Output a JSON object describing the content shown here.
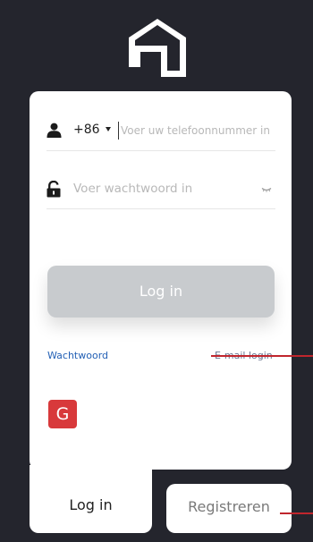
{
  "colors": {
    "background": "#24252d",
    "card": "#ffffff",
    "login_button": "#c8cbce",
    "link_blue": "#2360b5",
    "google_red": "#d8393b",
    "annotation_red": "#c0262d"
  },
  "logo": {
    "icon": "house-logo-icon"
  },
  "form": {
    "country_code": "+86",
    "phone_placeholder": "Voer uw telefoonnummer in",
    "password_placeholder": "Voer wachtwoord in",
    "login_label": "Log in",
    "forgot_password": "Wachtwoord",
    "email_login": "E-mail login"
  },
  "social": {
    "google_label": "G"
  },
  "tabs": {
    "login": "Log in",
    "register": "Registreren"
  }
}
